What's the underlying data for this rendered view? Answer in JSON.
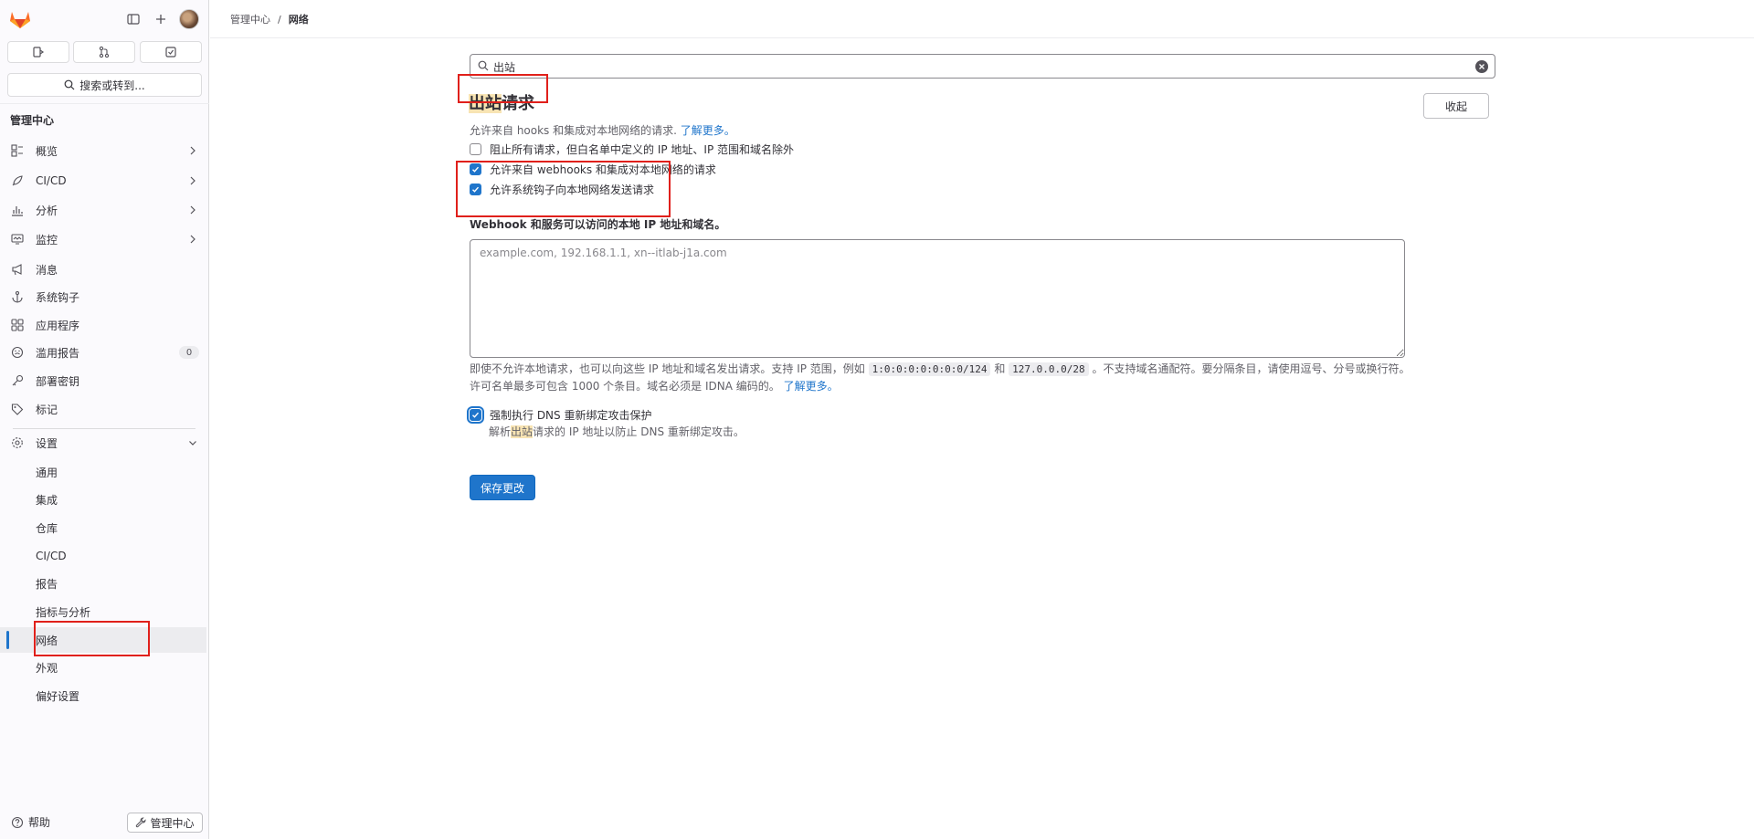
{
  "sidebar": {
    "search_label": "搜索或转到...",
    "section_title": "管理中心",
    "nav": [
      {
        "label": "概览"
      },
      {
        "label": "CI/CD"
      },
      {
        "label": "分析"
      },
      {
        "label": "监控"
      },
      {
        "label": "消息"
      },
      {
        "label": "系统钩子"
      },
      {
        "label": "应用程序"
      },
      {
        "label": "滥用报告",
        "badge": "0"
      },
      {
        "label": "部署密钥"
      },
      {
        "label": "标记"
      },
      {
        "label": "设置"
      }
    ],
    "settings_sub": [
      {
        "label": "通用"
      },
      {
        "label": "集成"
      },
      {
        "label": "仓库"
      },
      {
        "label": "CI/CD"
      },
      {
        "label": "报告"
      },
      {
        "label": "指标与分析"
      },
      {
        "label": "网络"
      },
      {
        "label": "外观"
      },
      {
        "label": "偏好设置"
      }
    ],
    "help_label": "帮助",
    "admin_label": "管理中心"
  },
  "breadcrumb": {
    "root": "管理中心",
    "separator": "/",
    "current": "网络"
  },
  "filter": {
    "value": "出站"
  },
  "section": {
    "title_highlight": "出站",
    "title_rest": "请求",
    "collapse_label": "收起",
    "description": "允许来自 hooks 和集成对本地网络的请求.",
    "learn_more": "了解更多。",
    "checkboxes": [
      {
        "label": "阻止所有请求，但白名单中定义的 IP 地址、IP 范围和域名除外",
        "checked": false
      },
      {
        "label": "允许来自 webhooks 和集成对本地网络的请求",
        "checked": true
      },
      {
        "label": "允许系统钩子向本地网络发送请求",
        "checked": true
      }
    ],
    "allowlist_label": "Webhook 和服务可以访问的本地 IP 地址和域名。",
    "allowlist_placeholder": "example.com, 192.168.1.1, xn--itlab-j1a.com",
    "help_part1": "即使不允许本地请求，也可以向这些 IP 地址和域名发出请求。支持 IP 范围，例如",
    "help_code1": "1:0:0:0:0:0:0:0/124",
    "help_and": "和",
    "help_code2": "127.0.0.0/28",
    "help_part2": "。不支持域名通配符。要分隔条目，请使用逗号、分号或换行符。许可名单最多可包含 1000 个条目。域名必须是 IDNA 编码的。",
    "help_learn_more": "了解更多。",
    "dns_label": "强制执行 DNS 重新绑定攻击保护",
    "dns_checked": true,
    "dns_help_prefix": "解析",
    "dns_help_highlight": "出站",
    "dns_help_suffix": "请求的 IP 地址以防止 DNS 重新绑定攻击。",
    "save_label": "保存更改"
  },
  "colors": {
    "primary": "#1f75cb",
    "highlight": "#f8e4b3",
    "annotation": "#e0201b"
  }
}
